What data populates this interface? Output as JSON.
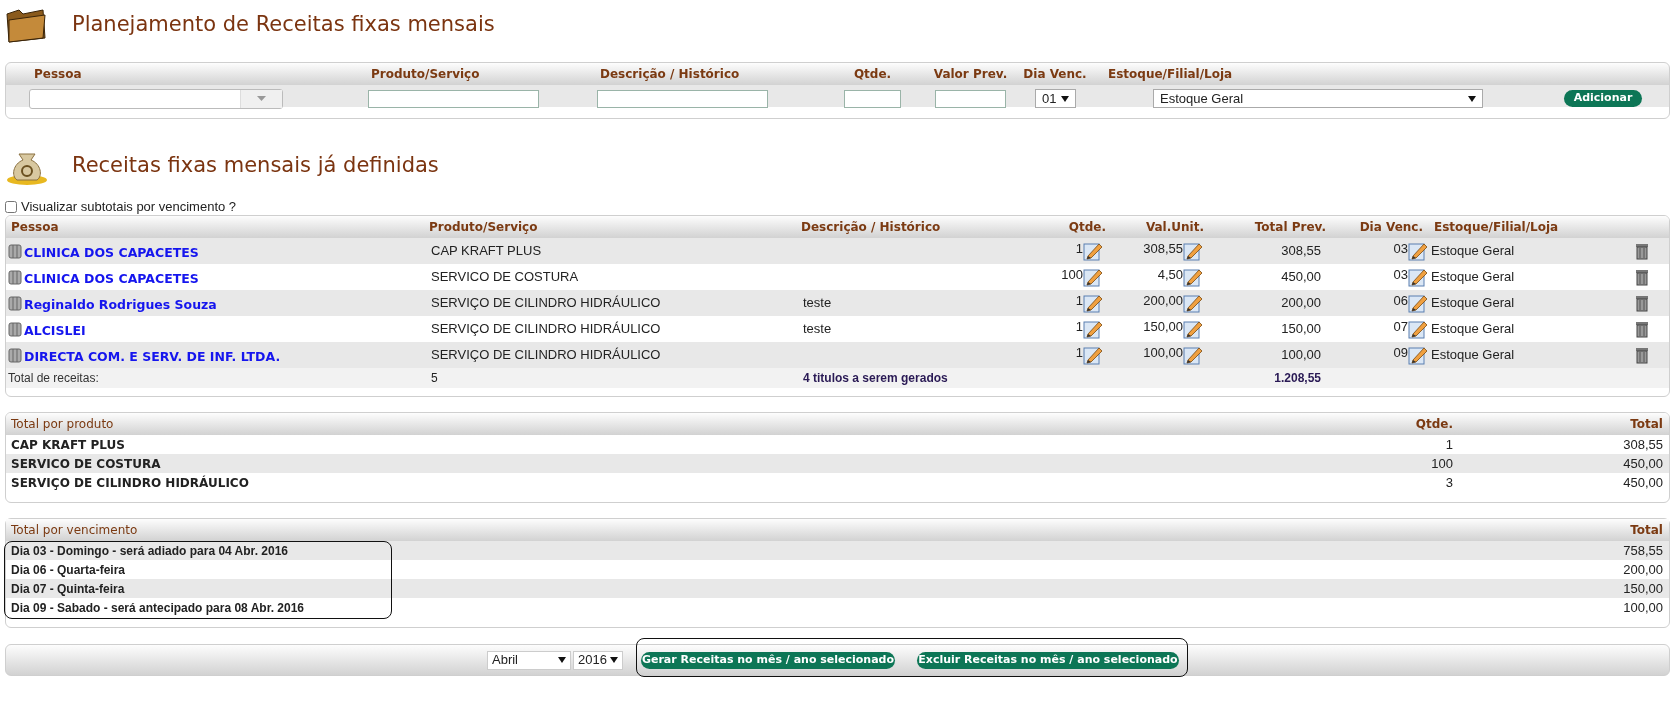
{
  "page_title": "Planejamento de Receitas fixas mensais",
  "entry_form": {
    "fields": [
      {
        "kind": "combobox",
        "label": "Pessoa"
      },
      {
        "kind": "text",
        "label": "Produto/Serviço"
      },
      {
        "kind": "text",
        "label": "Descrição / Histórico"
      },
      {
        "kind": "text",
        "label": "Qtde."
      },
      {
        "kind": "text",
        "label": "Valor Prev."
      },
      {
        "kind": "select",
        "label": "Dia Venc.",
        "value": "01"
      },
      {
        "kind": "select",
        "label": "Estoque/Filial/Loja",
        "value": "Estoque Geral"
      },
      {
        "kind": "button",
        "label": "Adicionar"
      }
    ]
  },
  "section_title": "Receitas fixas mensais já definidas",
  "subtotals_toggle": {
    "label": "Visualizar subtotais por vencimento ?",
    "checked": false
  },
  "receitas_table": {
    "columns": [
      "Pessoa",
      "Produto/Serviço",
      "Descrição / Histórico",
      "Qtde.",
      "Val.Unit.",
      "Total Prev.",
      "Dia Venc.",
      "Estoque/Filial/Loja"
    ],
    "rows": [
      {
        "pessoa": "CLINICA DOS CAPACETES",
        "produto": "CAP KRAFT PLUS",
        "qtde": "1",
        "val_unit": "308,55",
        "total_prev": "308,55",
        "dia_venc": "03",
        "estoque": "Estoque Geral"
      },
      {
        "pessoa": "CLINICA DOS CAPACETES",
        "produto": "SERVICO DE COSTURA",
        "qtde": "100",
        "val_unit": "4,50",
        "total_prev": "450,00",
        "dia_venc": "03",
        "estoque": "Estoque Geral"
      },
      {
        "pessoa": "Reginaldo Rodrigues Souza",
        "produto": "SERVIÇO DE CILINDRO HIDRÁULICO",
        "descricao": "teste",
        "qtde": "1",
        "val_unit": "200,00",
        "total_prev": "200,00",
        "dia_venc": "06",
        "estoque": "Estoque Geral"
      },
      {
        "pessoa": "ALCISLEI",
        "produto": "SERVIÇO DE CILINDRO HIDRÁULICO",
        "descricao": "teste",
        "qtde": "1",
        "val_unit": "150,00",
        "total_prev": "150,00",
        "dia_venc": "07",
        "estoque": "Estoque Geral"
      },
      {
        "pessoa": "DIRECTA COM. E SERV. DE INF. LTDA.",
        "produto": "SERVIÇO DE CILINDRO HIDRÁULICO",
        "qtde": "1",
        "val_unit": "100,00",
        "total_prev": "100,00",
        "dia_venc": "09",
        "estoque": "Estoque Geral"
      }
    ],
    "footer": {
      "label": "Total de receitas:",
      "count": "5",
      "note": "4 titulos a serem gerados",
      "total": "1.208,55"
    }
  },
  "total_por_produto": {
    "columns": [
      "Total por produto",
      "Qtde.",
      "Total"
    ],
    "rows": [
      {
        "produto": "CAP KRAFT PLUS",
        "qtde": "1",
        "total": "308,55"
      },
      {
        "produto": "SERVICO DE COSTURA",
        "qtde": "100",
        "total": "450,00"
      },
      {
        "produto": "SERVIÇO DE CILINDRO HIDRÁULICO",
        "qtde": "3",
        "total": "450,00"
      }
    ]
  },
  "total_por_vencimento": {
    "columns": [
      "Total por vencimento",
      "Total"
    ],
    "outlined": true,
    "rows": [
      {
        "label": "Dia 03 - Domingo - será adiado para 04 Abr. 2016",
        "total": "758,55"
      },
      {
        "label": "Dia 06 - Quarta-feira",
        "total": "200,00"
      },
      {
        "label": "Dia 07 - Quinta-feira",
        "total": "150,00"
      },
      {
        "label": "Dia 09 - Sabado - será antecipado para 08 Abr. 2016",
        "total": "100,00"
      }
    ]
  },
  "generate_bar": {
    "month": "Abril",
    "year": "2016",
    "outlined": true,
    "buttons": [
      "Gerar Receitas no mês / ano selecionado",
      "Excluir Receitas no mês / ano selecionado"
    ]
  }
}
